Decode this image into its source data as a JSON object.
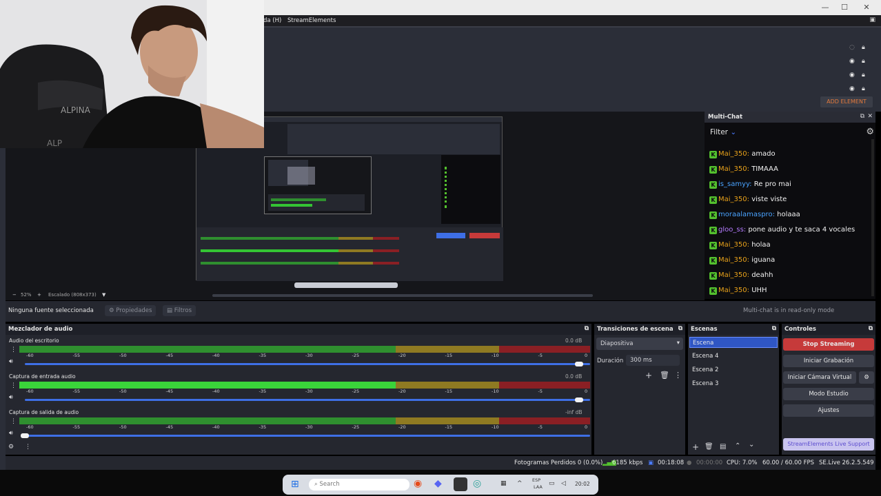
{
  "menu": {
    "items": [
      "da (H)",
      "StreamElements"
    ]
  },
  "window": {
    "min": "—",
    "max": "☐",
    "close": "✕"
  },
  "sources": {
    "add_element": "ADD ELEMENT",
    "eye_icon": "eye-icon",
    "lock_icon": "lock-icon"
  },
  "webcam": {
    "chair_brand": "ALPINA",
    "chair_brand2": "ALP"
  },
  "preview": {
    "zoom": "52%",
    "scale": "Escalado (808x373)",
    "zoom_minus": "−",
    "zoom_plus": "+",
    "dropdown": "▼"
  },
  "props_row": {
    "no_source": "Ninguna fuente seleccionada",
    "properties": "Propiedades",
    "filters": "Filtros"
  },
  "multichat": {
    "title": "Multi-Chat",
    "filter": "Filter",
    "footer": "Multi-chat is in read-only mode",
    "messages": [
      {
        "user": "Mai_350:",
        "text": "amado",
        "color": "#e9a21a"
      },
      {
        "user": "Mai_350:",
        "text": "TIMAAA",
        "color": "#e9a21a"
      },
      {
        "user": "is_samyy:",
        "text": "Re pro mai",
        "color": "#4aa3ff"
      },
      {
        "user": "Mai_350:",
        "text": "viste viste",
        "color": "#e9a21a"
      },
      {
        "user": "moraalamaspro:",
        "text": "holaaa",
        "color": "#4aa3ff"
      },
      {
        "user": "gloo_ss:",
        "text": "pone audio y te saca 4 vocales",
        "color": "#b57cff"
      },
      {
        "user": "Mai_350:",
        "text": "holaa",
        "color": "#e9a21a"
      },
      {
        "user": "Mai_350:",
        "text": "iguana",
        "color": "#e9a21a"
      },
      {
        "user": "Mai_350:",
        "text": "deahh",
        "color": "#e9a21a"
      },
      {
        "user": "Mai_350:",
        "text": "UHH",
        "color": "#e9a21a"
      }
    ]
  },
  "mixer": {
    "title": "Mezclador de audio",
    "channels": [
      {
        "name": "Audio del escritorio",
        "db": "0.0 dB",
        "level": 0.0
      },
      {
        "name": "Captura de entrada audio",
        "db": "0.0 dB",
        "level": 0.66
      },
      {
        "name": "Captura de salida de audio",
        "db": "-inf dB",
        "level": 0.0
      }
    ],
    "ticks": [
      "-60",
      "-55",
      "-50",
      "-45",
      "-40",
      "-35",
      "-30",
      "-25",
      "-20",
      "-15",
      "-10",
      "-5",
      "0"
    ]
  },
  "transitions": {
    "title": "Transiciones de escena",
    "selected": "Diapositiva",
    "duration_label": "Duración",
    "duration_value": "300 ms"
  },
  "scenes": {
    "title": "Escenas",
    "items": [
      "Escena",
      "Escena 4",
      "Escena 2",
      "Escena 3"
    ]
  },
  "controls": {
    "title": "Controles",
    "stop_streaming": "Stop Streaming",
    "start_recording": "Iniciar Grabación",
    "virtual_cam": "Iniciar Cámara Virtual",
    "studio_mode": "Modo Estudio",
    "settings": "Ajustes",
    "se_support": "StreamElements Live Support"
  },
  "status": {
    "dropped": "Fotogramas Perdidos 0 (0.0%)",
    "bitrate": "6185 kbps",
    "live_time": "00:18:08",
    "rec_time": "00:00:00",
    "cpu": "CPU: 7.0%",
    "fps": "60.00 / 60.00 FPS",
    "version": "SE.Live 26.2.5.549"
  },
  "taskbar": {
    "search": "Search",
    "lang": "ESP",
    "lang_sub": "LAA",
    "time": "20:02"
  },
  "colors": {
    "accent_blue": "#3e6fe6",
    "stop_red": "#c63a3a",
    "meter_green": "#2f8f2f",
    "meter_yellow": "#8f7a22",
    "meter_red": "#8a1f24"
  }
}
